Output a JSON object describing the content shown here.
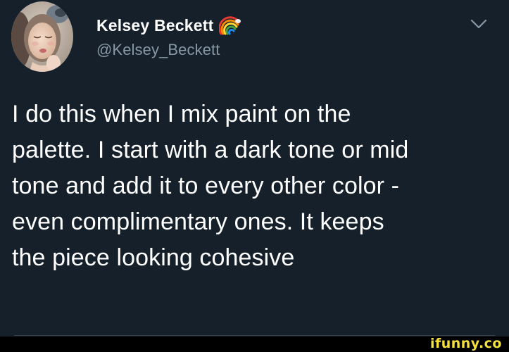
{
  "author": {
    "display_name": "Kelsey Beckett",
    "handle": "@Kelsey_Beckett",
    "badge_icon": "rainbow-icon"
  },
  "tweet": {
    "lines": [
      "I do this when I mix paint on the",
      "palette. I start with a dark tone or mid",
      "tone and add it to every other color -",
      "even complimentary ones. It keeps",
      "the piece looking cohesive"
    ]
  },
  "menu": {
    "icon": "chevron-down-icon"
  },
  "watermark": {
    "text": "ifunny.co"
  },
  "colors": {
    "background": "#15202b",
    "text": "#ffffff",
    "secondary_text": "#8899a6",
    "watermark": "#f5e13c"
  }
}
